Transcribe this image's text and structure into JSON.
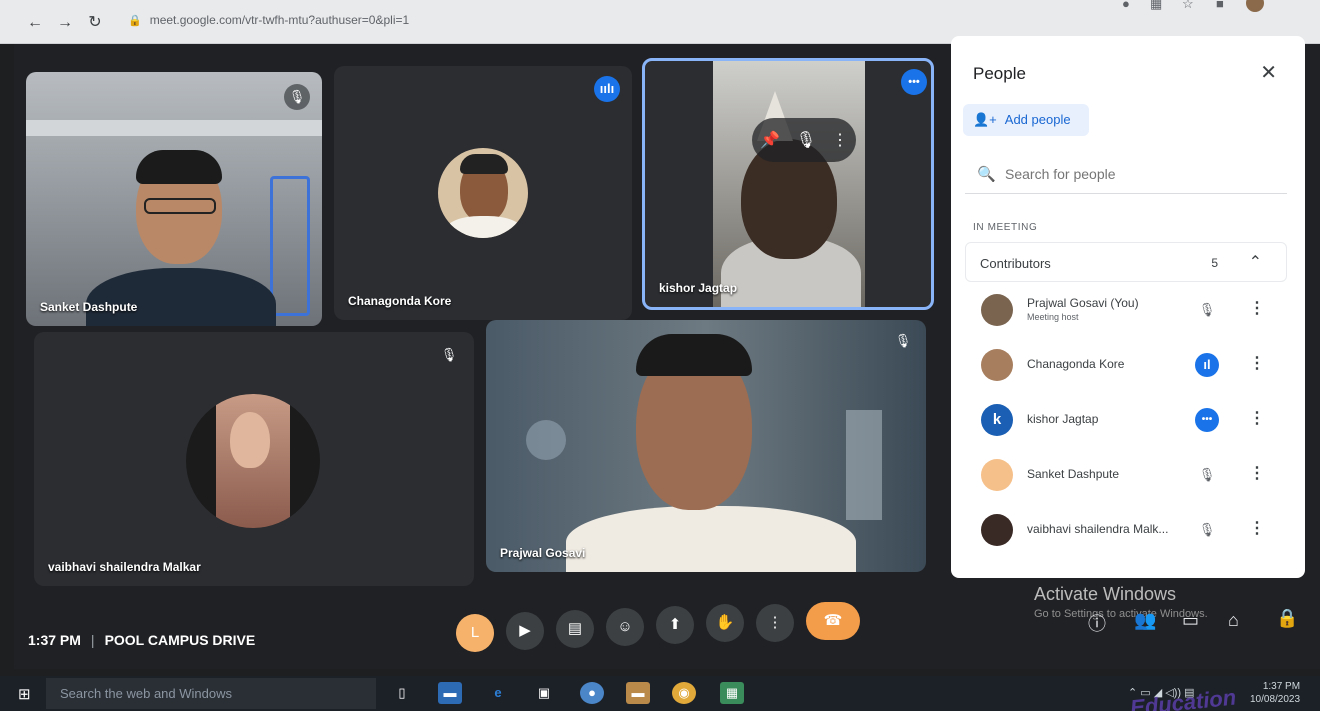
{
  "browser": {
    "url": "meet.google.com/vtr-twfh-mtu?authuser=0&pli=1"
  },
  "tiles": [
    {
      "name": "Sanket Dashpute",
      "mic_off": true
    },
    {
      "name": "Chanagonda Kore",
      "speaking": true
    },
    {
      "name": "kishor Jagtap",
      "more_badge": true
    },
    {
      "name": "vaibhavi shailendra Malkar",
      "mic_off": true
    },
    {
      "name": "Prajwal Gosavi",
      "mic_off": true
    }
  ],
  "people_panel": {
    "title": "People",
    "add_people_label": "Add people",
    "search_placeholder": "Search for people",
    "section_label": "IN MEETING",
    "group_label": "Contributors",
    "group_count": "5",
    "participants": [
      {
        "name": "Prajwal Gosavi (You)",
        "subtitle": "Meeting host",
        "state": "mic-off"
      },
      {
        "name": "Chanagonda Kore",
        "state": "speaking"
      },
      {
        "name": "kishor Jagtap",
        "initial": "k",
        "state": "more"
      },
      {
        "name": "Sanket Dashpute",
        "state": "mic-off"
      },
      {
        "name": "vaibhavi shailendra Malk...",
        "state": "mic-off"
      }
    ]
  },
  "meeting_bar": {
    "time": "1:37 PM",
    "meeting_name": "POOL CAMPUS DRIVE",
    "user_initial": "L"
  },
  "windows": {
    "activate_title": "Activate Windows",
    "activate_sub": "Go to Settings to activate Windows.",
    "taskbar_search": "Search the web and Windows",
    "clock_time": "1:37 PM",
    "clock_date": "10/08/2023"
  },
  "watermark": "Education",
  "colors": {
    "meet_bg": "#202124",
    "accent_blue": "#1a73e8",
    "hangup": "#f39c4a",
    "avatar_orange": "#f6b26b"
  }
}
